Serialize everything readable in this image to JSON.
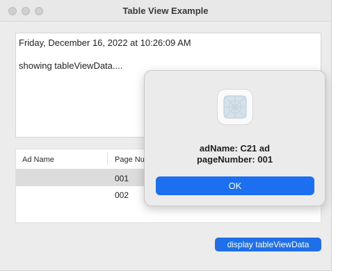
{
  "window": {
    "title": "Table View Example"
  },
  "output": {
    "line1": "Friday, December 16, 2022 at 10:26:09 AM",
    "line2": "showing tableViewData...."
  },
  "table": {
    "columns": [
      "Ad Name",
      "Page Nu"
    ],
    "rows": [
      {
        "ad": "",
        "page": "001"
      },
      {
        "ad": "",
        "page": "002"
      }
    ]
  },
  "buttons": {
    "display_label": "display tableViewData"
  },
  "alert": {
    "line1": "adName: C21 ad",
    "line2": "pageNumber: 001",
    "ok_label": "OK"
  },
  "colors": {
    "accent": "#1e6fe8",
    "selected_row": "#dcdcdc"
  },
  "icons": [
    "app-placeholder-icon"
  ]
}
